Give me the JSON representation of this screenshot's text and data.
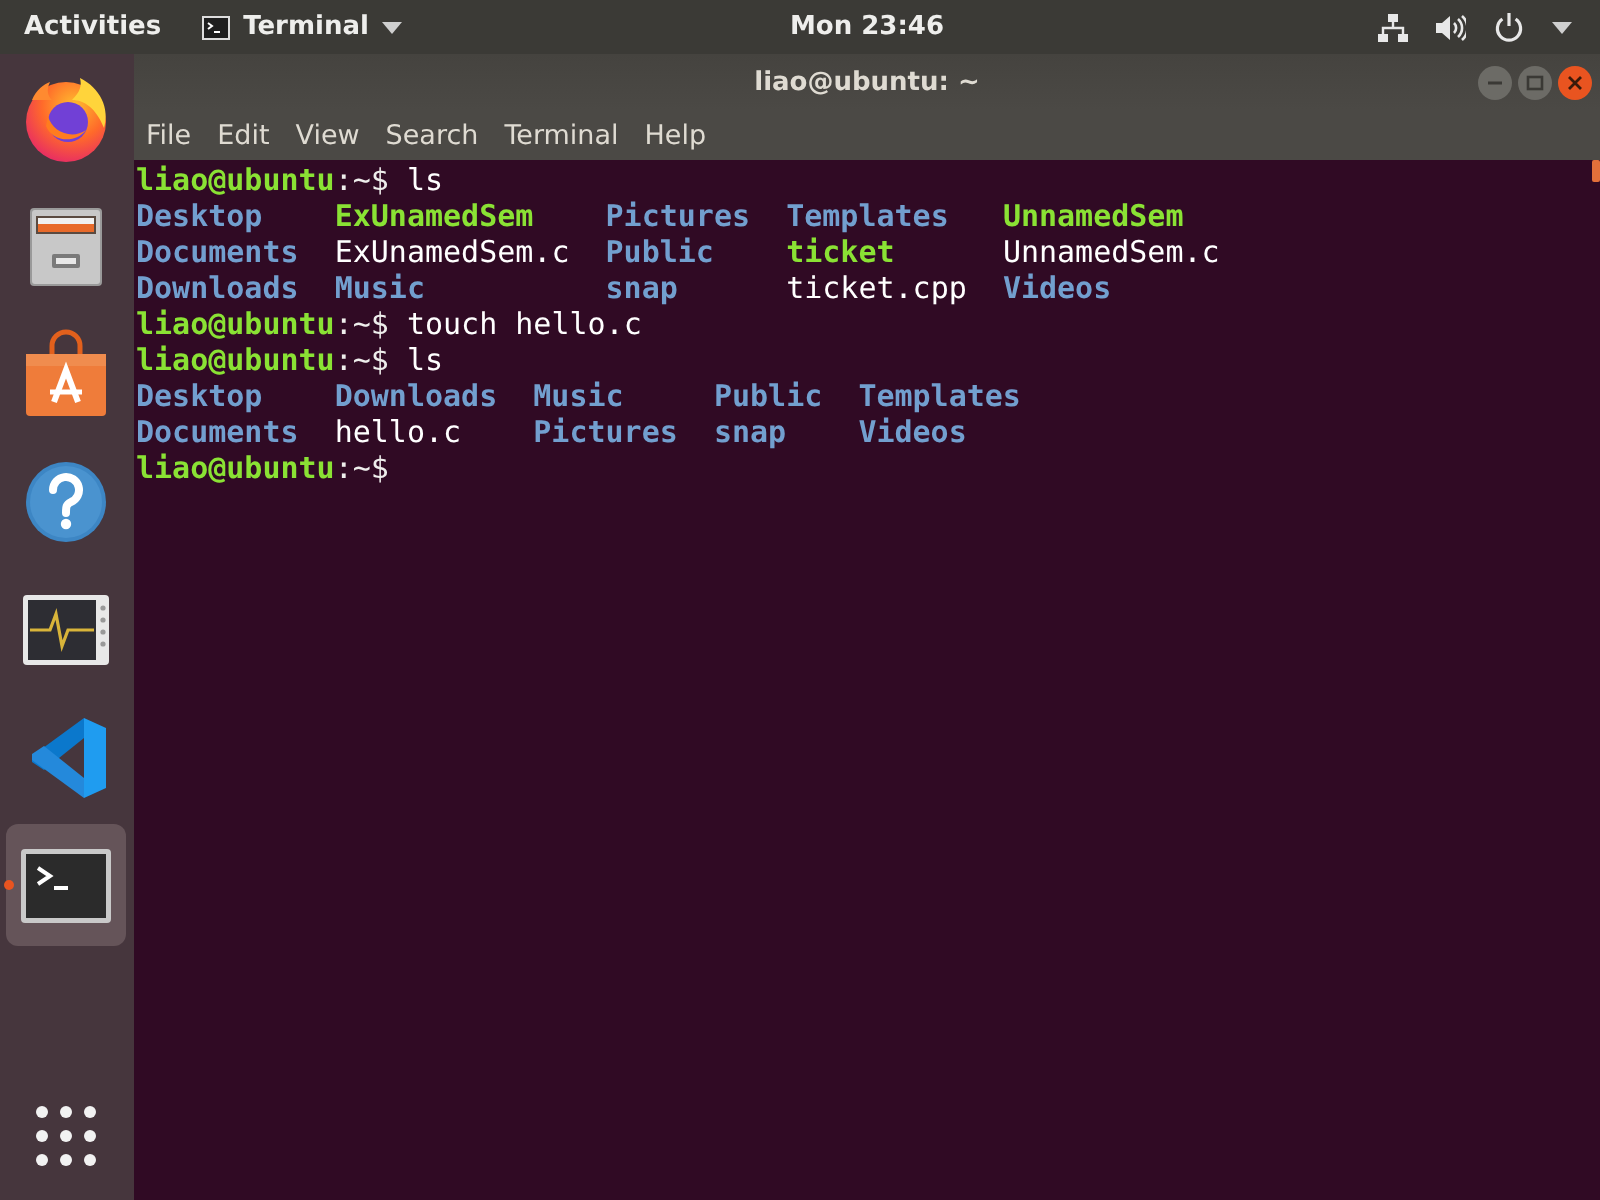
{
  "top_bar": {
    "activities": "Activities",
    "app_menu": {
      "label": "Terminal"
    },
    "clock": "Mon 23:46"
  },
  "dock": {
    "items": [
      {
        "kind": "browser",
        "running": false,
        "selected": false
      },
      {
        "kind": "files",
        "running": false,
        "selected": false
      },
      {
        "kind": "software",
        "running": false,
        "selected": false
      },
      {
        "kind": "help",
        "running": false,
        "selected": false
      },
      {
        "kind": "monitor",
        "running": false,
        "selected": false
      },
      {
        "kind": "code",
        "running": false,
        "selected": false
      },
      {
        "kind": "terminal",
        "running": true,
        "selected": true
      }
    ]
  },
  "window": {
    "title": "liao@ubuntu: ~",
    "menu": [
      "File",
      "Edit",
      "View",
      "Search",
      "Terminal",
      "Help"
    ]
  },
  "terminal": {
    "lines": [
      {
        "kind": "prompt",
        "user": "liao@ubuntu",
        "suffix": ":~$",
        "command": "ls"
      },
      {
        "kind": "listing",
        "rows": [
          [
            {
              "name": "Desktop",
              "kind": "directory"
            },
            {
              "name": "ExUnamedSem",
              "kind": "executable"
            },
            {
              "name": "Pictures",
              "kind": "directory"
            },
            {
              "name": "Templates",
              "kind": "directory"
            },
            {
              "name": "UnnamedSem",
              "kind": "executable"
            }
          ],
          [
            {
              "name": "Documents",
              "kind": "directory"
            },
            {
              "name": "ExUnamedSem.c",
              "kind": "file"
            },
            {
              "name": "Public",
              "kind": "directory"
            },
            {
              "name": "ticket",
              "kind": "executable"
            },
            {
              "name": "UnnamedSem.c",
              "kind": "file"
            }
          ],
          [
            {
              "name": "Downloads",
              "kind": "directory"
            },
            {
              "name": "Music",
              "kind": "directory"
            },
            {
              "name": "snap",
              "kind": "directory"
            },
            {
              "name": "ticket.cpp",
              "kind": "file"
            },
            {
              "name": "Videos",
              "kind": "directory"
            }
          ]
        ]
      },
      {
        "kind": "prompt",
        "user": "liao@ubuntu",
        "suffix": ":~$",
        "command": "touch hello.c"
      },
      {
        "kind": "prompt",
        "user": "liao@ubuntu",
        "suffix": ":~$",
        "command": "ls"
      },
      {
        "kind": "listing",
        "rows": [
          [
            {
              "name": "Desktop",
              "kind": "directory"
            },
            {
              "name": "Downloads",
              "kind": "directory"
            },
            {
              "name": "Music",
              "kind": "directory"
            },
            {
              "name": "Public",
              "kind": "directory"
            },
            {
              "name": "Templates",
              "kind": "directory"
            }
          ],
          [
            {
              "name": "Documents",
              "kind": "directory"
            },
            {
              "name": "hello.c",
              "kind": "file"
            },
            {
              "name": "Pictures",
              "kind": "directory"
            },
            {
              "name": "snap",
              "kind": "directory"
            },
            {
              "name": "Videos",
              "kind": "directory"
            }
          ]
        ]
      },
      {
        "kind": "prompt",
        "user": "liao@ubuntu",
        "suffix": ":~$"
      }
    ]
  }
}
